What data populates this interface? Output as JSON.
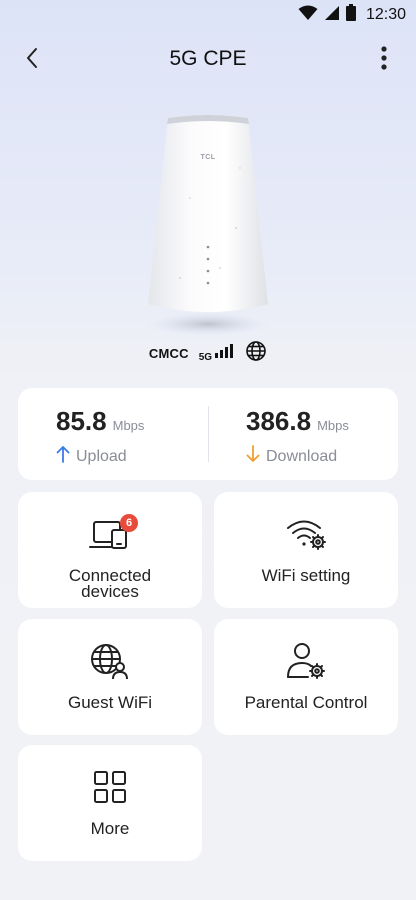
{
  "status_bar": {
    "time": "12:30",
    "icons": [
      "wifi-icon",
      "cellular-signal-icon",
      "battery-icon"
    ]
  },
  "header": {
    "title": "5G CPE",
    "back_icon": "chevron-left-icon",
    "menu_icon": "more-vertical-icon"
  },
  "device": {
    "brand_text": "TCL",
    "carrier": "CMCC",
    "network_type": "5G",
    "signal_bars": 4,
    "globe_icon": "globe-icon"
  },
  "speed": {
    "upload": {
      "value": "85.8",
      "unit": "Mbps",
      "label": "Upload",
      "color": "#3b7be8"
    },
    "download": {
      "value": "386.8",
      "unit": "Mbps",
      "label": "Download",
      "color": "#f0a030"
    }
  },
  "tiles": [
    {
      "label": "Connected devices",
      "label_line1": "Connected",
      "label_line2": "devices",
      "icon": "devices-icon",
      "badge": "6"
    },
    {
      "label": "WiFi setting",
      "icon": "wifi-settings-icon"
    },
    {
      "label": "Guest WiFi",
      "icon": "guest-globe-icon"
    },
    {
      "label": "Parental Control",
      "icon": "parental-control-icon"
    },
    {
      "label": "More",
      "icon": "grid-icon"
    }
  ],
  "colors": {
    "accent_badge": "#e84b3c",
    "card_bg": "#ffffff",
    "upload_arrow": "#3b7be8",
    "download_arrow": "#f0a030"
  }
}
